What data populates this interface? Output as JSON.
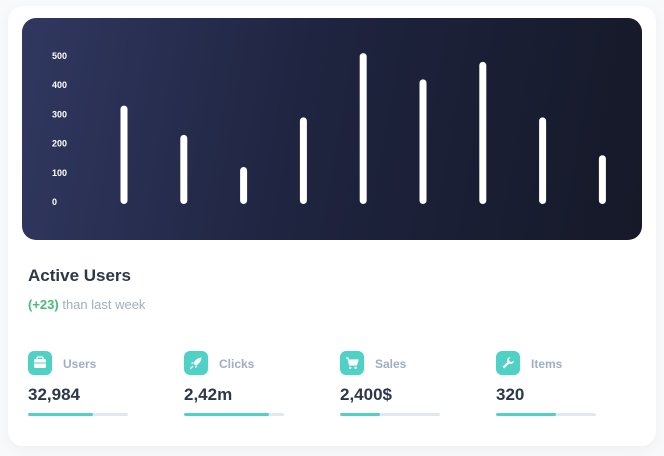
{
  "chart_data": {
    "type": "bar",
    "categories": [
      "",
      "",
      "",
      "",
      "",
      "",
      "",
      "",
      ""
    ],
    "values": [
      330,
      230,
      120,
      290,
      510,
      420,
      480,
      290,
      160
    ],
    "yticks": [
      0,
      100,
      200,
      300,
      400,
      500
    ],
    "ylim": [
      0,
      500
    ],
    "title": "",
    "xlabel": "",
    "ylabel": "",
    "grid": false,
    "bar_color": "#ffffff"
  },
  "card": {
    "title": "Active Users",
    "delta": "(+23)",
    "subtitle_rest": " than last week"
  },
  "stats": [
    {
      "label": "Users",
      "value": "32,984",
      "progress": 0.65,
      "icon": "wallet-icon"
    },
    {
      "label": "Clicks",
      "value": "2,42m",
      "progress": 0.85,
      "icon": "rocket-icon"
    },
    {
      "label": "Sales",
      "value": "2,400$",
      "progress": 0.4,
      "icon": "cart-icon"
    },
    {
      "label": "Items",
      "value": "320",
      "progress": 0.6,
      "icon": "wrench-icon"
    }
  ],
  "colors": {
    "accent": "#4fd1c5",
    "positive": "#48bb78",
    "chart_dark": "#151928",
    "chart_navy": "#313860"
  }
}
